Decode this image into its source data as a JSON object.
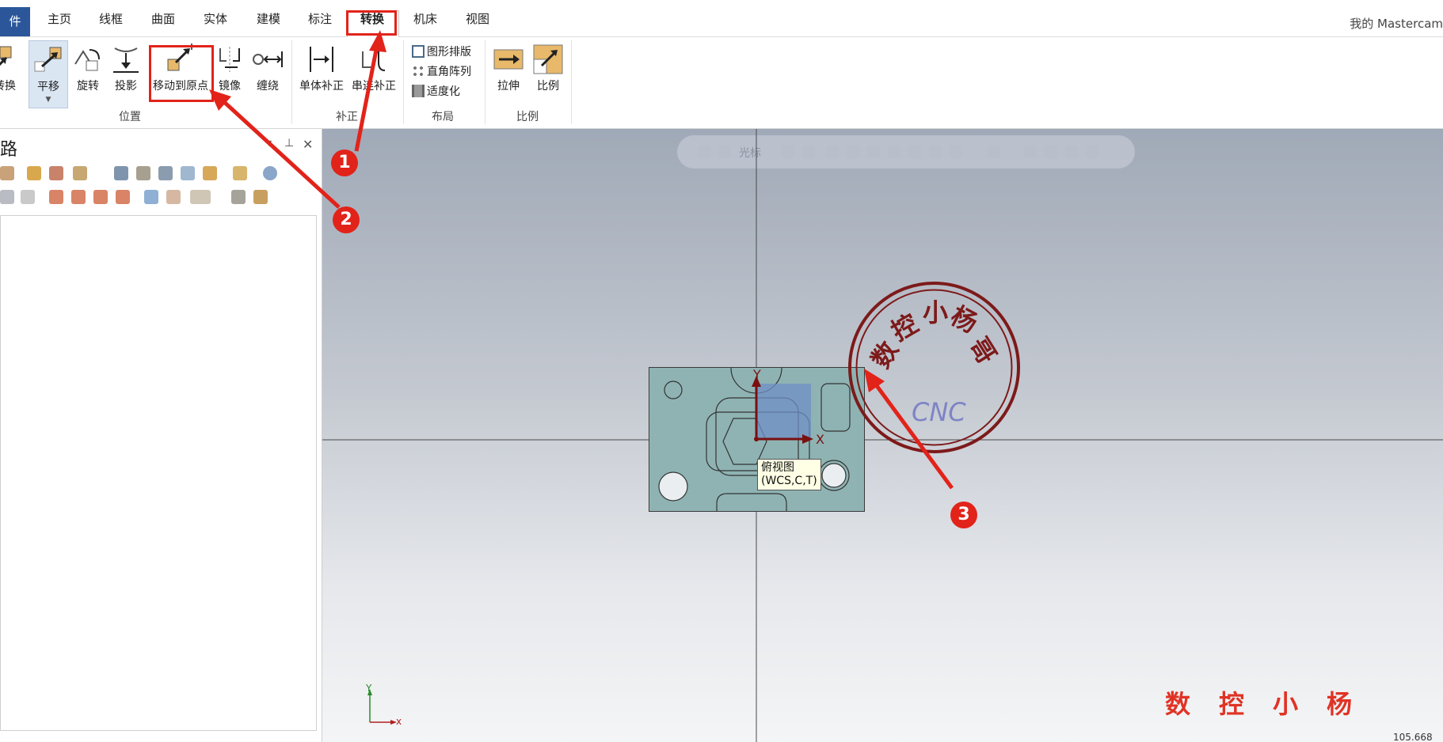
{
  "menubar": {
    "file_tab": "件",
    "tabs": [
      "主页",
      "线框",
      "曲面",
      "实体",
      "建模",
      "标注",
      "转换",
      "机床",
      "视图"
    ],
    "active_tab": "转换",
    "user_label": "我的 Mastercam"
  },
  "ribbon": {
    "position_group": {
      "label": "位置",
      "buttons": [
        "转换",
        "平移",
        "旋转",
        "投影",
        "移动到原点",
        "镜像",
        "缠绕"
      ]
    },
    "offset_group": {
      "label": "补正",
      "buttons": [
        "单体补正",
        "串连补正"
      ]
    },
    "layout_group": {
      "label": "布局",
      "buttons": [
        "图形排版",
        "直角阵列",
        "适度化"
      ]
    },
    "scale_group": {
      "label": "比例",
      "buttons": [
        "拉伸",
        "比例"
      ]
    }
  },
  "left_panel": {
    "title": "路",
    "pin_icon": "pin-icon",
    "close_icon": "close-icon"
  },
  "viewport": {
    "toolbar": {
      "cursor_label": "光标"
    },
    "axis_labels": {
      "x": "X",
      "y": "Y"
    },
    "tooltip": [
      "俯视图",
      "(WCS,C,T)"
    ],
    "stamp": {
      "text": "数控小杨哥",
      "sub": "CNC"
    },
    "watermark": "数控小杨",
    "mini_axis": {
      "x": "x",
      "y": "Y"
    },
    "corner_value": "105.668"
  },
  "annotations": {
    "callouts": [
      "1",
      "2",
      "3"
    ],
    "color": "#e2231a"
  },
  "colors": {
    "accent": "#2b579a",
    "highlight": "#e2231a",
    "part_fill": "#8fb3b3",
    "stamp": "#7d1a1a"
  }
}
